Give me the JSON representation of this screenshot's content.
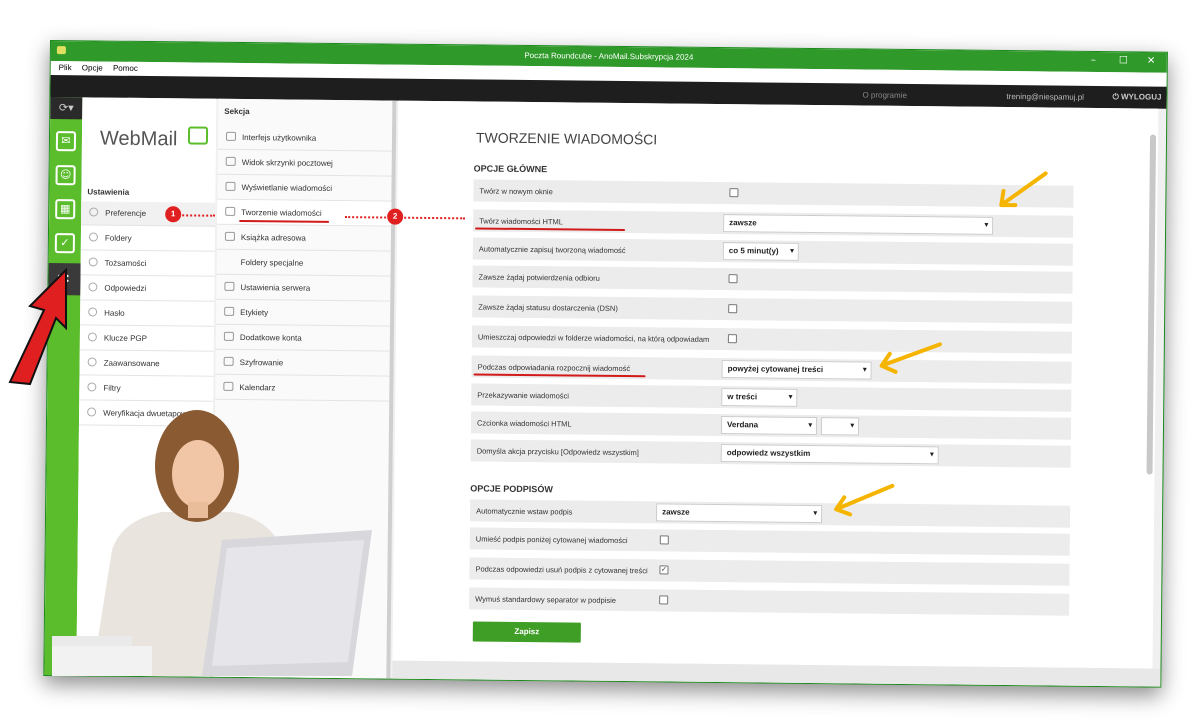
{
  "window": {
    "title": "Poczta Roundcube - AnoMail.Subskrypcja 2024",
    "controls": {
      "minimize": "–",
      "maximize": "☐",
      "close": "✕"
    }
  },
  "menubar": {
    "items": [
      "Plik",
      "Opcje",
      "Pomoc"
    ]
  },
  "topbar": {
    "about": "O programie",
    "user": "trening@niespamuj.pl",
    "logout": "WYLOGUJ"
  },
  "rail": {
    "refresh_glyph": "⟳▾"
  },
  "brand": {
    "name": "WebMail"
  },
  "settings": {
    "heading": "Ustawienia",
    "items": [
      {
        "label": "Preferencje",
        "icon": "preferences-icon",
        "active": true
      },
      {
        "label": "Foldery",
        "icon": "folder-icon"
      },
      {
        "label": "Tożsamości",
        "icon": "identity-icon"
      },
      {
        "label": "Odpowiedzi",
        "icon": "gear-icon"
      },
      {
        "label": "Hasło",
        "icon": "gear-icon"
      },
      {
        "label": "Klucze PGP",
        "icon": "key-icon"
      },
      {
        "label": "Zaawansowane",
        "icon": "gear-icon"
      },
      {
        "label": "Filtry",
        "icon": "gear-icon"
      },
      {
        "label": "Weryfikacja dwuetapowa",
        "icon": "key-icon"
      }
    ]
  },
  "sections": {
    "heading": "Sekcja",
    "items": [
      {
        "label": "Interfejs użytkownika",
        "icon": "window-icon"
      },
      {
        "label": "Widok skrzynki pocztowej",
        "icon": "mailbox-icon"
      },
      {
        "label": "Wyświetlanie wiadomości",
        "icon": "envelope-icon"
      },
      {
        "label": "Tworzenie wiadomości",
        "icon": "pencil-icon",
        "active": true
      },
      {
        "label": "Książka adresowa",
        "icon": "addressbook-icon"
      },
      {
        "label": "Foldery specjalne",
        "icon": ""
      },
      {
        "label": "Ustawienia serwera",
        "icon": "gear-icon"
      },
      {
        "label": "Etykiety",
        "icon": "tag-icon"
      },
      {
        "label": "Dodatkowe konta",
        "icon": "at-icon"
      },
      {
        "label": "Szyfrowanie",
        "icon": "key-icon"
      },
      {
        "label": "Kalendarz",
        "icon": "calendar-icon"
      }
    ]
  },
  "annotations": {
    "badge1": "1",
    "badge2": "2"
  },
  "main": {
    "title": "TWORZENIE WIADOMOŚCI",
    "groups": {
      "main": "OPCJE GŁÓWNE",
      "signature": "OPCJE PODPISÓW"
    },
    "rows": {
      "new_window": {
        "label": "Twórz w nowym oknie",
        "checked": false
      },
      "html": {
        "label": "Twórz wiadomości HTML",
        "value": "zawsze"
      },
      "autosave": {
        "label": "Automatycznie zapisuj tworzoną wiadomość",
        "value": "co 5 minut(y)"
      },
      "read_receipt": {
        "label": "Zawsze żądaj potwierdzenia odbioru",
        "checked": false
      },
      "dsn": {
        "label": "Zawsze żądaj statusu dostarczenia (DSN)",
        "checked": false
      },
      "reply_folder": {
        "label": "Umieszczaj odpowiedzi w folderze wiadomości, na którą odpowiadam",
        "checked": false
      },
      "reply_start": {
        "label": "Podczas odpowiadania rozpocznij wiadomość",
        "value": "powyżej cytowanej treści"
      },
      "forward": {
        "label": "Przekazywanie wiadomości",
        "value": "w treści"
      },
      "font": {
        "label": "Czcionka wiadomości HTML",
        "value": "Verdana",
        "size_value": ""
      },
      "reply_all": {
        "label": "Domyśla akcja przycisku [Odpowiedz wszystkim]",
        "value": "odpowiedz wszystkim"
      },
      "auto_sig": {
        "label": "Automatycznie wstaw podpis",
        "value": "zawsze"
      },
      "sig_below": {
        "label": "Umieść podpis poniżej cytowanej wiadomości",
        "checked": false
      },
      "sig_strip": {
        "label": "Podczas odpowiedzi usuń podpis z cytowanej treści",
        "checked": true,
        "mark": "✓"
      },
      "sig_sep": {
        "label": "Wymuś standardowy separator w podpisie",
        "checked": false
      }
    },
    "save_label": "Zapisz",
    "chevron": "▾"
  },
  "colors": {
    "accent": "#3f9e26",
    "rail": "#5bbd2c",
    "titlebar": "#2f9a2a",
    "annotation": "#e02020",
    "highlight_arrow": "#f5b400"
  }
}
